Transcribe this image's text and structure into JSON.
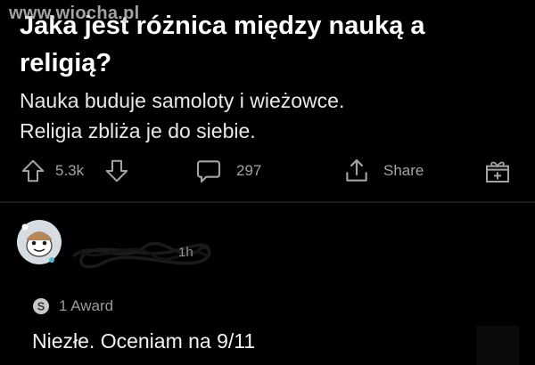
{
  "post": {
    "title": "Jaka jest różnica między nauką a religią?",
    "body_line1": "Nauka buduje samoloty i wieżowce.",
    "body_line2": "Religia zbliża je do siebie.",
    "watermark": "www.wiocha.pl"
  },
  "actions": {
    "upvote_icon": "arrow-up-icon",
    "vote_count": "5.3k",
    "downvote_icon": "arrow-down-icon",
    "comment_icon": "comment-bubble-icon",
    "comment_count": "297",
    "share_icon": "share-icon",
    "share_label": "Share",
    "award_icon": "gift-icon"
  },
  "comment": {
    "avatar_icon": "avatar-snoo-icon",
    "time": "1h",
    "award_icon": "silver-award-icon",
    "award_label": "1 Award",
    "text": "Niezłe. Oceniam na 9/11"
  },
  "colors": {
    "background": "#000000",
    "text_primary": "#ffffff",
    "text_muted": "#a3a3a3"
  }
}
